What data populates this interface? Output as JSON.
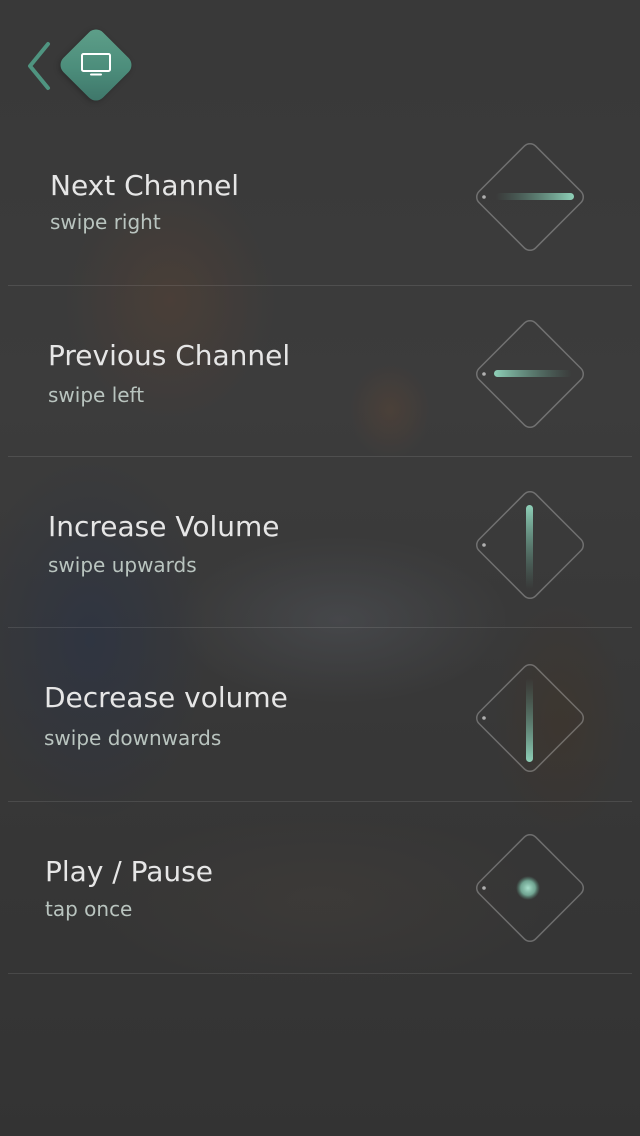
{
  "header": {
    "back_icon": "chevron-left-icon",
    "device_icon": "tv-icon",
    "accent_color": "#4f9480"
  },
  "gestures": [
    {
      "title": "Next Channel",
      "hint": "swipe right",
      "diagram": "swipe-right"
    },
    {
      "title": "Previous Channel",
      "hint": "swipe left",
      "diagram": "swipe-left"
    },
    {
      "title": "Increase Volume",
      "hint": "swipe upwards",
      "diagram": "swipe-up"
    },
    {
      "title": "Decrease volume",
      "hint": "swipe downwards",
      "diagram": "swipe-down"
    },
    {
      "title": "Play / Pause",
      "hint": "tap once",
      "diagram": "tap"
    }
  ]
}
